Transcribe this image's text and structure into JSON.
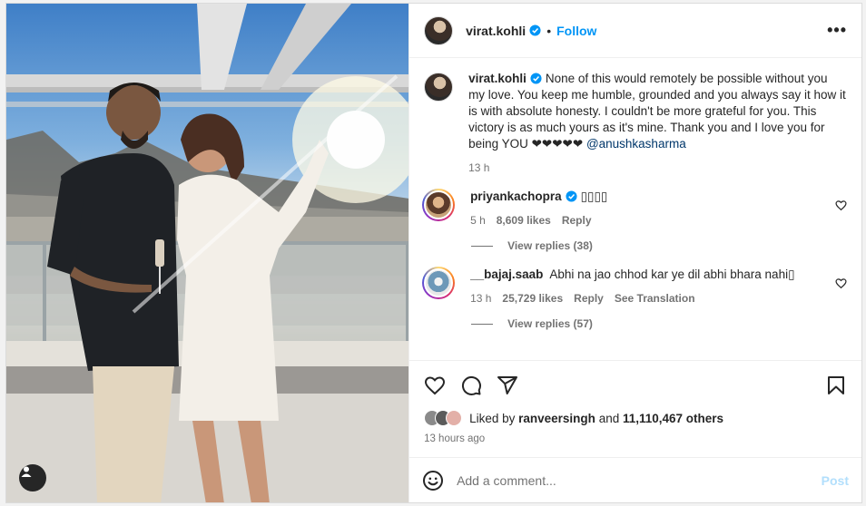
{
  "post": {
    "author": "virat.kohli",
    "follow_label": "Follow",
    "separator": "•",
    "more_label": "•••",
    "caption_user": "virat.kohli",
    "caption_text": "None of this would remotely be possible without you my love. You keep me humble, grounded and you always say it how it is with absolute honesty. I couldn't be more grateful for you. This victory is as much yours as it's mine. Thank you and I love you for being YOU ❤❤❤❤❤",
    "caption_mention": "@anushkasharma",
    "caption_time": "13 h"
  },
  "comments": [
    {
      "user": "priyankachopra",
      "text": "▯▯▯▯",
      "time": "5 h",
      "likes": "8,609 likes",
      "reply": "Reply",
      "view_replies": "View replies (38)"
    },
    {
      "user": "__bajaj.saab",
      "text": "Abhi na jao chhod kar ye dil abhi bhara nahi▯",
      "time": "13 h",
      "likes": "25,729 likes",
      "reply": "Reply",
      "translation": "See Translation",
      "view_replies": "View replies (57)"
    }
  ],
  "likes": {
    "prefix": "Liked by",
    "user": "ranveersingh",
    "and": "and",
    "others": "11,110,467 others"
  },
  "time_ago": "13 hours ago",
  "add_comment": {
    "placeholder": "Add a comment...",
    "post_label": "Post"
  },
  "icons": {
    "heart": "heart-icon",
    "comment": "comment-icon",
    "share": "share-icon",
    "bookmark": "bookmark-icon",
    "emoji": "emoji-icon",
    "verified": "verified-badge-icon",
    "user": "user-tag-icon"
  },
  "colors": {
    "accent": "#0095f6",
    "mention": "#00376b",
    "muted": "#737373",
    "verified": "#0095f6"
  }
}
